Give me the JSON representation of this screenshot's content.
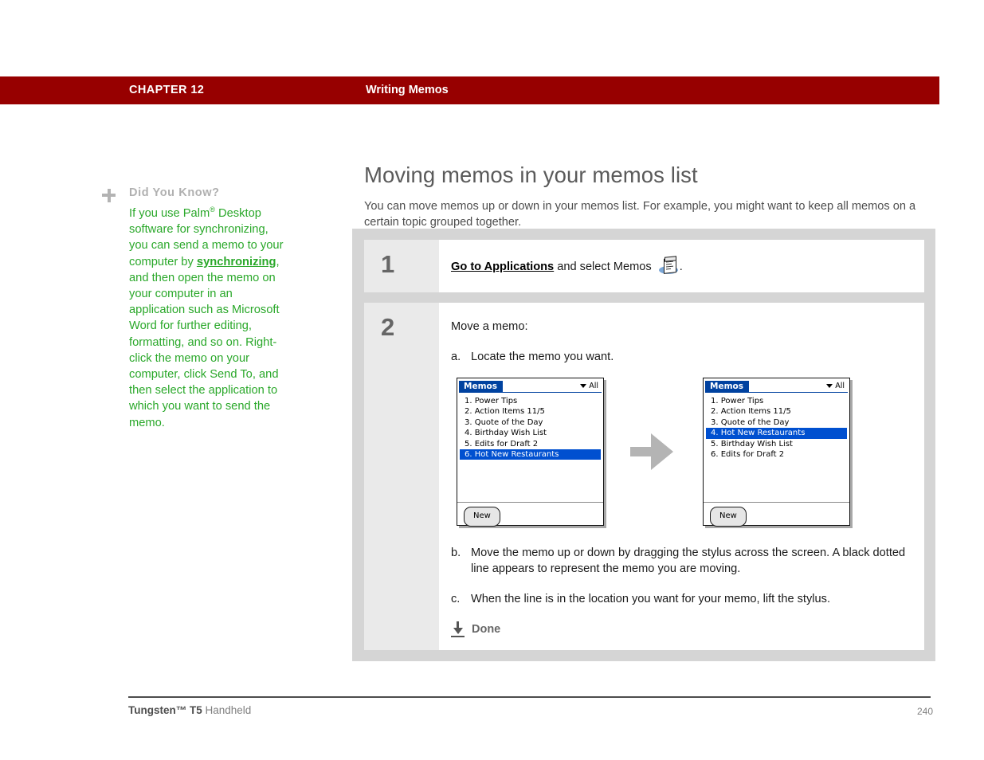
{
  "header": {
    "chapter": "CHAPTER 12",
    "title": "Writing Memos",
    "bar_color": "#970000"
  },
  "sidebar": {
    "icon": "plus-icon",
    "title": "Did You Know?",
    "accent_color": "#2aa82a",
    "body_parts": {
      "p1": "If you use Palm",
      "sup": "®",
      "p2": " Desktop software for synchronizing, you can send a memo to your computer by ",
      "link": "synchronizing",
      "p3": ", and then open the memo on your computer in an application such as Microsoft Word for further editing, formatting, and so on. Right-click the memo on your computer, click Send To, and then select the application to which you want to send the memo."
    }
  },
  "main": {
    "page_title": "Moving memos in your memos list",
    "intro": "You can move memos up or down in your memos list. For example, you might want to keep all memos on a certain topic grouped together."
  },
  "steps": [
    {
      "number": "1",
      "link_text": "Go to Applications",
      "rest_before_icon": " and select Memos ",
      "icon": "memos-app-icon",
      "rest_after_icon": "."
    },
    {
      "number": "2",
      "heading": "Move a memo:",
      "items": [
        {
          "label": "a.",
          "text": "Locate the memo you want."
        },
        {
          "label": "b.",
          "text": "Move the memo up or down by dragging the stylus across the screen. A black dotted line appears to represent the memo you are moving."
        },
        {
          "label": "c.",
          "text": "When the line is in the location you want for your memo, lift the stylus."
        }
      ],
      "done_label": "Done",
      "done_icon": "down-arrow-icon"
    }
  ],
  "screenshots": {
    "arrow_icon": "right-arrow-icon",
    "before": {
      "app_title": "Memos",
      "category": "All",
      "category_icon": "chevron-down-icon",
      "new_button": "New",
      "selected_index": 5,
      "rows": [
        "1. Power Tips",
        "2. Action Items 11/5",
        "3. Quote of the Day",
        "4. Birthday Wish List",
        "5. Edits for Draft 2",
        "6. Hot New Restaurants"
      ]
    },
    "after": {
      "app_title": "Memos",
      "category": "All",
      "category_icon": "chevron-down-icon",
      "new_button": "New",
      "selected_index": 3,
      "rows": [
        "1. Power Tips",
        "2. Action Items 11/5",
        "3. Quote of the Day",
        "4. Hot New Restaurants",
        "5. Birthday Wish List",
        "6. Edits for Draft 2"
      ]
    }
  },
  "footer": {
    "product_bold": "Tungsten™ T5",
    "product_rest": " Handheld",
    "page_number": "240"
  }
}
